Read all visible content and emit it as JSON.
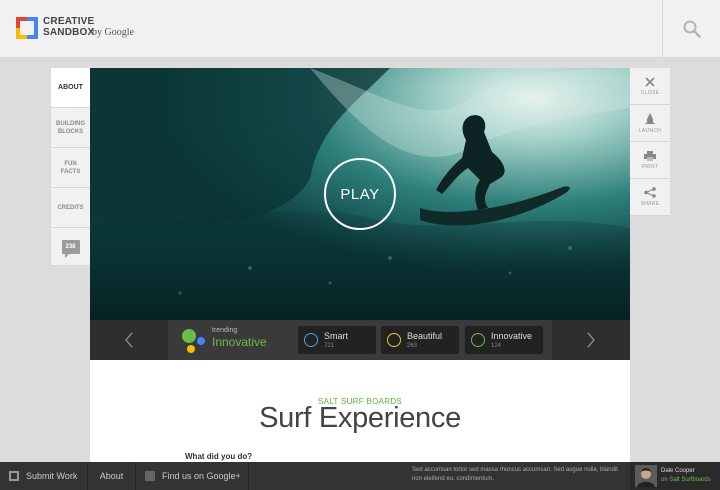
{
  "header": {
    "brand_line1": "CREATIVE",
    "brand_line2": "SANDBOX",
    "brand_by": "by Google"
  },
  "left_tabs": [
    {
      "label": "ABOUT"
    },
    {
      "label": "BUILDING BLOCKS"
    },
    {
      "label": "FUN FACTS"
    },
    {
      "label": "CREDITS"
    }
  ],
  "comment_count": "238",
  "hero": {
    "play_label": "PLAY"
  },
  "right_tools": [
    {
      "label": "CLOSE",
      "icon": "close-icon"
    },
    {
      "label": "LAUNCH",
      "icon": "launch-icon"
    },
    {
      "label": "PRINT",
      "icon": "print-icon"
    },
    {
      "label": "SHARE",
      "icon": "share-icon"
    }
  ],
  "trending": {
    "small": "trending",
    "big": "Innovative",
    "chips": [
      {
        "name": "Smart",
        "count": "721",
        "color": "#4aa3df",
        "icon": "lightbulb-icon"
      },
      {
        "name": "Beautiful",
        "count": "263",
        "color": "#e5c43a",
        "icon": "crown-icon"
      },
      {
        "name": "Innovative",
        "count": "124",
        "color": "#6dbb49",
        "icon": "innovation-icon"
      }
    ]
  },
  "content": {
    "kicker": "SALT SURF BOARDS",
    "title": "Surf Experience",
    "question": "What did you do?"
  },
  "footer": {
    "submit": "Submit Work",
    "about": "About",
    "gplus": "Find us on Google+",
    "blurb": "Sed accumsan tortor sed massa rhoncus accumsan. Sed augue nulla, blandit non eleifend eu, condimentum.",
    "user_name": "Dale Cooper",
    "user_on": "on",
    "user_project": "Salt Surfboards"
  },
  "colors": {
    "accent_green": "#6dbb49",
    "logo_red": "#e94335",
    "logo_blue": "#4285f4",
    "logo_yellow": "#fbbc05",
    "logo_green": "#34a853"
  }
}
